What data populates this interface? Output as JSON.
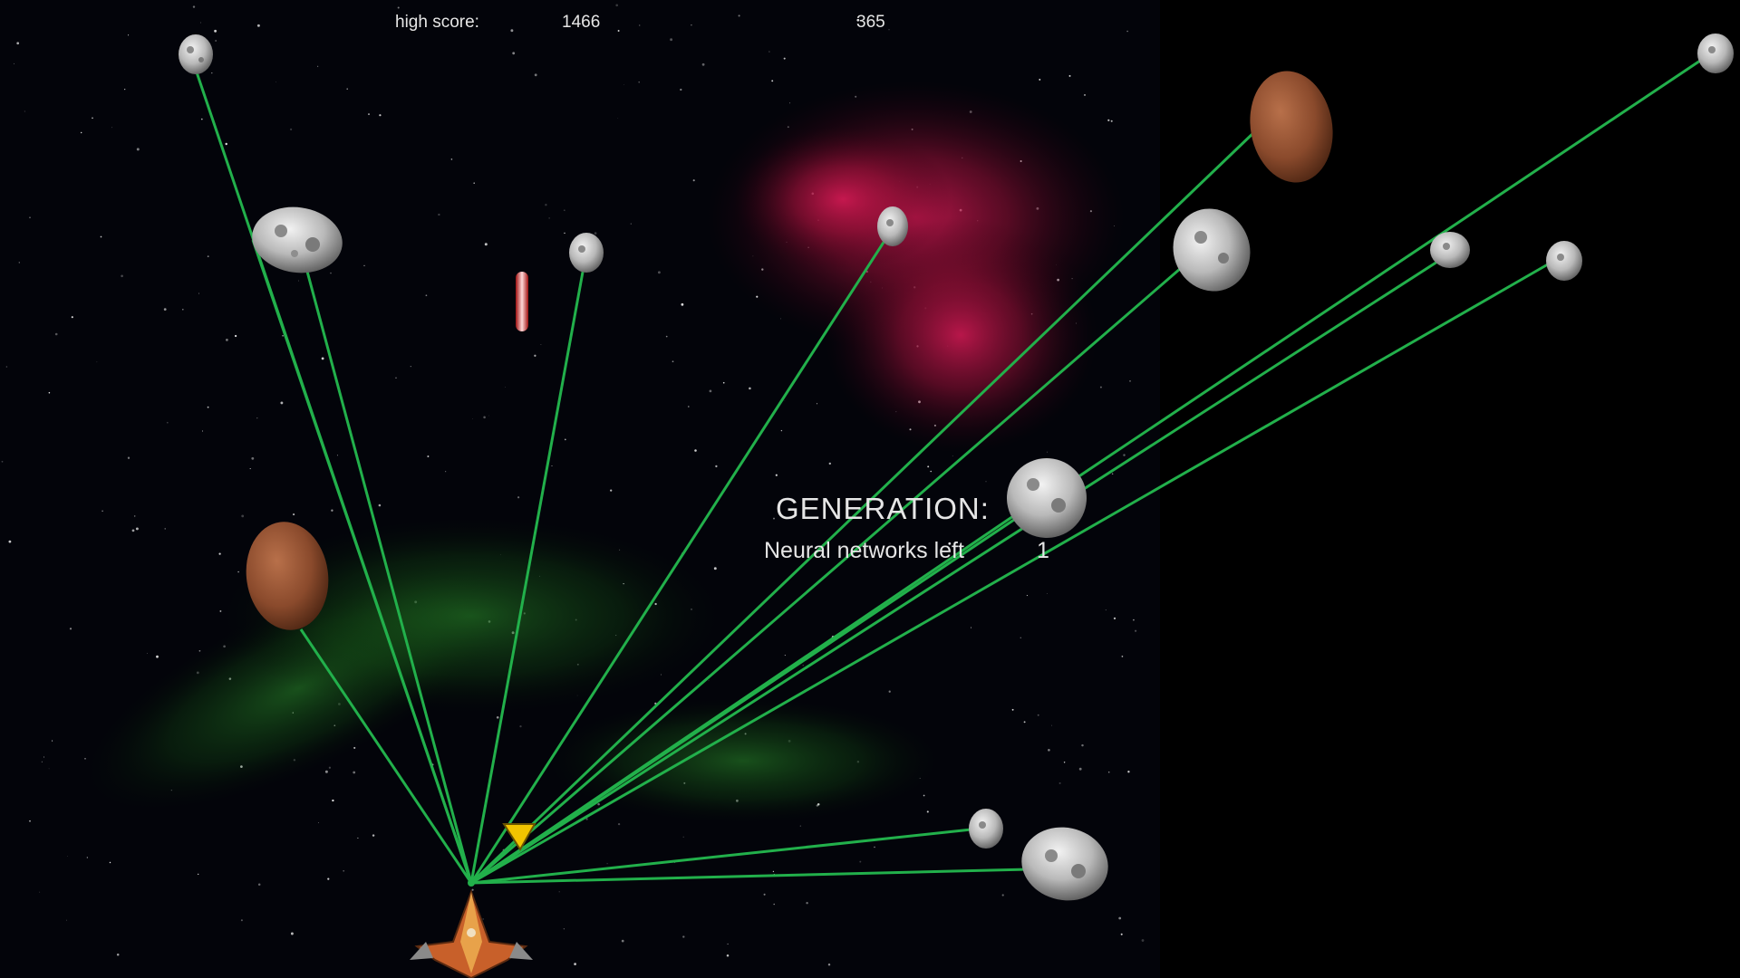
{
  "hud": {
    "high_score_label": "high score:",
    "high_score_value": "1466",
    "current_score": "365",
    "generation_label": "GENERATION:",
    "networks_left_label": "Neural networks left",
    "networks_left_value": "1"
  },
  "colors": {
    "sensor_line": "#22b04b",
    "background": "#000000",
    "nebula_red": "#c8184a",
    "nebula_green": "#1f7a1f",
    "hud_text": "#e6e6e6"
  },
  "entities": {
    "player": "spaceship-icon",
    "laser": "laser-bolt-icon",
    "powerup": "yellow-shard-icon",
    "asteroid_gray": "gray-asteroid-icon",
    "asteroid_brown": "brown-asteroid-icon"
  }
}
